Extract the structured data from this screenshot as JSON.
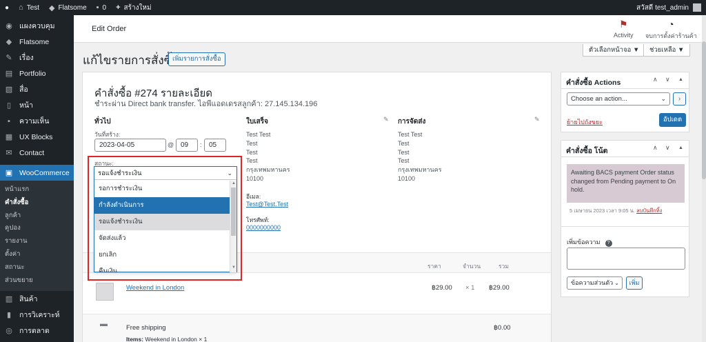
{
  "adminbar": {
    "site": "Test",
    "theme": "Flatsome",
    "comments": "0",
    "new": "สร้างใหม่",
    "greeting": "สวัสดี test_admin"
  },
  "sidebar": {
    "items": [
      {
        "label": "แผงควบคุม",
        "icon": "dashboard-icon"
      },
      {
        "label": "Flatsome",
        "icon": "flatsome-icon"
      },
      {
        "label": "เรื่อง",
        "icon": "pin-icon"
      },
      {
        "label": "Portfolio",
        "icon": "portfolio-icon"
      },
      {
        "label": "สื่อ",
        "icon": "media-icon"
      },
      {
        "label": "หน้า",
        "icon": "page-icon"
      },
      {
        "label": "ความเห็น",
        "icon": "comment-icon"
      },
      {
        "label": "UX Blocks",
        "icon": "blocks-icon"
      },
      {
        "label": "Contact",
        "icon": "mail-icon"
      }
    ],
    "current": {
      "label": "WooCommerce",
      "icon": "woo-icon"
    },
    "submenu": [
      "หน้าแรก",
      "คำสั่งซื้อ",
      "ลูกค้า",
      "คูปอง",
      "รายงาน",
      "ตั้งค่า",
      "สถานะ",
      "ส่วนขยาย"
    ],
    "after": [
      {
        "label": "สินค้า",
        "icon": "product-icon"
      },
      {
        "label": "การวิเคราะห์",
        "icon": "analytics-icon"
      },
      {
        "label": "การตลาด",
        "icon": "marketing-icon"
      }
    ]
  },
  "header": {
    "title": "Edit Order",
    "activity": "Activity",
    "store_setup": "จบการตั้งค่าร้านค้า"
  },
  "screen_options": "ตัวเลือกหน้าจอ ▼",
  "help": "ช่วยเหลือ ▼",
  "page": {
    "title": "แก้ไขรายการสั่งซื้อ",
    "add_order": "เพิ่มรายการสั่งซื้อ"
  },
  "order": {
    "heading": "คำสั่งซื้อ #274 รายละเอียด",
    "meta": "ชำระผ่าน Direct bank transfer. ไอพีแอดเดรสลูกค้า: 27.145.134.196",
    "general": {
      "heading": "ทั่วไป",
      "created_label": "วันที่สร้าง:",
      "date": "2023-04-05",
      "at": "@",
      "hour": "09",
      "colon": ":",
      "minute": "05",
      "status_label": "สถานะ:"
    },
    "billing": {
      "heading": "ใบเสร็จ",
      "lines": [
        "Test Test",
        "Test",
        "Test",
        "Test",
        "กรุงเทพมหานคร",
        "10100"
      ],
      "email_label": "อีเมล:",
      "email": "Test@Test.Test",
      "phone_label": "โทรศัพท์:",
      "phone": "0000000000"
    },
    "shipping": {
      "heading": "การจัดส่ง",
      "lines": [
        "Test Test",
        "Test",
        "Test",
        "Test",
        "กรุงเทพมหานคร",
        "10100"
      ]
    }
  },
  "status_dropdown": {
    "value": "รอแจ้งชำระเงิน",
    "options": [
      "รอการชำระเงิน",
      "กำลังดำเนินการ",
      "รอแจ้งชำระเงิน",
      "จัดส่งแล้ว",
      "ยกเลิก",
      "คืนเงิน"
    ]
  },
  "items": {
    "headers": {
      "price": "ราคา",
      "qty": "จำนวน",
      "total": "รวม"
    },
    "rows": [
      {
        "name": "Weekend in London",
        "price": "฿29.00",
        "qty": "× 1",
        "total": "฿29.00"
      }
    ],
    "shipping": {
      "name": "Free shipping",
      "items_label": "Items:",
      "items": "Weekend in London × 1",
      "total": "฿0.00"
    }
  },
  "actions_box": {
    "title": "คำสั่งซื้อ Actions",
    "placeholder": "Choose an action...",
    "go": "›",
    "trash": "ย้ายไปถังขยะ",
    "update": "อัปเดต"
  },
  "notes_box": {
    "title": "คำสั่งซื้อ โน้ต",
    "note": "Awaiting BACS payment Order status changed from Pending payment to On hold.",
    "meta": "5 เมษายน 2023 เวลา 9:05 น.",
    "delete": "ลบบันทึกทิ้ง",
    "add_label": "เพิ่มข้อความ",
    "help": "?",
    "type": "ข้อความส่วนตัว",
    "add_btn": "เพิ่ม"
  },
  "colors": {
    "admin_dark": "#1d2327",
    "primary": "#2271b1",
    "highlight": "#e02424",
    "note_bg": "#d7cad2"
  }
}
